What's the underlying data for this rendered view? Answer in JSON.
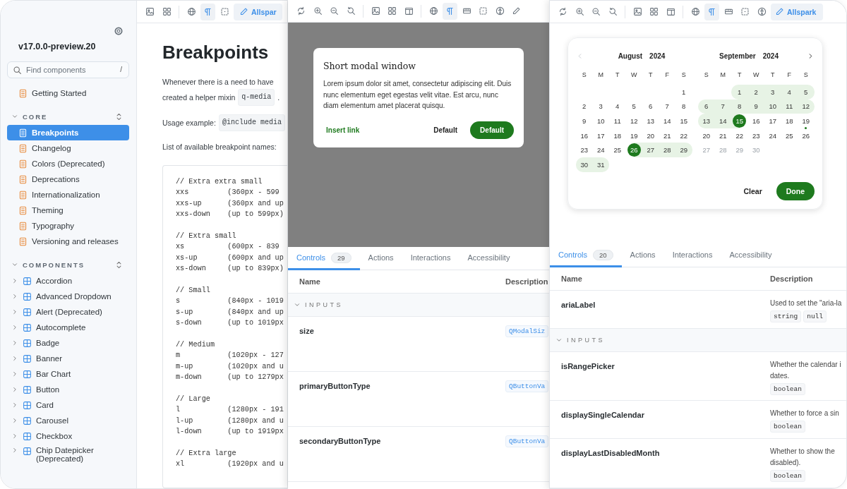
{
  "docs_window": {
    "sidebar": {
      "version": "v17.0.0-preview.20",
      "search": {
        "placeholder": "Find components",
        "shortcut": "/"
      },
      "top_items": [
        {
          "label": "Getting Started",
          "kind": "doc",
          "selected": false
        }
      ],
      "sections": [
        {
          "title": "CORE",
          "expanded": true,
          "items": [
            {
              "label": "Breakpoints",
              "kind": "doc",
              "selected": true
            },
            {
              "label": "Changelog",
              "kind": "doc",
              "selected": false
            },
            {
              "label": "Colors (Deprecated)",
              "kind": "doc",
              "selected": false
            },
            {
              "label": "Deprecations",
              "kind": "doc",
              "selected": false
            },
            {
              "label": "Internationalization",
              "kind": "doc",
              "selected": false
            },
            {
              "label": "Theming",
              "kind": "doc",
              "selected": false
            },
            {
              "label": "Typography",
              "kind": "doc",
              "selected": false
            },
            {
              "label": "Versioning and releases",
              "kind": "doc",
              "selected": false
            }
          ]
        },
        {
          "title": "COMPONENTS",
          "expanded": true,
          "items": [
            {
              "label": "Accordion",
              "kind": "component",
              "selected": false,
              "expanded": false
            },
            {
              "label": "Advanced Dropdown",
              "kind": "component",
              "selected": false,
              "expanded": false
            },
            {
              "label": "Alert (Deprecated)",
              "kind": "component",
              "selected": false,
              "expanded": false
            },
            {
              "label": "Autocomplete",
              "kind": "component",
              "selected": false,
              "expanded": false
            },
            {
              "label": "Badge",
              "kind": "component",
              "selected": false,
              "expanded": false
            },
            {
              "label": "Banner",
              "kind": "component",
              "selected": false,
              "expanded": false
            },
            {
              "label": "Bar Chart",
              "kind": "component",
              "selected": false,
              "expanded": false
            },
            {
              "label": "Button",
              "kind": "component",
              "selected": false,
              "expanded": false
            },
            {
              "label": "Card",
              "kind": "component",
              "selected": false,
              "expanded": false
            },
            {
              "label": "Carousel",
              "kind": "component",
              "selected": false,
              "expanded": false
            },
            {
              "label": "Checkbox",
              "kind": "component",
              "selected": false,
              "expanded": false
            },
            {
              "label": "Chip Datepicker (Deprecated)",
              "kind": "component",
              "selected": false,
              "expanded": false
            }
          ]
        }
      ]
    },
    "toolbar": [
      {
        "kind": "background",
        "selected": false
      },
      {
        "kind": "grid",
        "selected": false
      },
      {
        "kind": "separator"
      },
      {
        "kind": "locale",
        "selected": false
      },
      {
        "kind": "direction",
        "selected": true
      },
      {
        "kind": "outline",
        "selected": false
      },
      {
        "kind": "edit",
        "label": "Allspar"
      }
    ],
    "content": {
      "title": "Breakpoints",
      "paragraphs": [
        [
          {
            "text": "Whenever there is a need to have"
          }
        ],
        [
          {
            "text": "created a helper mixin"
          },
          {
            "code": "q-media"
          },
          {
            "text": "."
          }
        ],
        [
          {
            "text": "Usage example:"
          },
          {
            "code": "@include media"
          }
        ],
        [
          {
            "text": "List of available breakpoint names:"
          }
        ]
      ],
      "code_block": [
        {
          "comment": "// Extra extra small",
          "lines": [
            "xxs         (360px - 599",
            "xxs-up      (360px and up",
            "xxs-down    (up to 599px)"
          ]
        },
        {
          "comment": "// Extra small",
          "lines": [
            "xs          (600px - 839",
            "xs-up       (600px and up",
            "xs-down     (up to 839px)"
          ]
        },
        {
          "comment": "// Small",
          "lines": [
            "s           (840px - 1019",
            "s-up        (840px and up",
            "s-down      (up to 1019px"
          ]
        },
        {
          "comment": "// Medium",
          "lines": [
            "m           (1020px - 127",
            "m-up        (1020px and u",
            "m-down      (up to 1279px"
          ]
        },
        {
          "comment": "// Large",
          "lines": [
            "l           (1280px - 191",
            "l-up        (1280px and u",
            "l-down      (up to 1919px"
          ]
        },
        {
          "comment": "// Extra large",
          "lines": [
            "xl          (1920px and u"
          ]
        }
      ]
    }
  },
  "modal_window": {
    "toolbar": [
      {
        "kind": "reload",
        "selected": false
      },
      {
        "kind": "zoom-in",
        "selected": false
      },
      {
        "kind": "zoom-out",
        "selected": false
      },
      {
        "kind": "zoom-reset",
        "selected": false
      },
      {
        "kind": "separator"
      },
      {
        "kind": "background",
        "selected": false
      },
      {
        "kind": "grid",
        "selected": false
      },
      {
        "kind": "viewport",
        "selected": false
      },
      {
        "kind": "separator"
      },
      {
        "kind": "locale",
        "selected": false
      },
      {
        "kind": "direction",
        "selected": true
      },
      {
        "kind": "measure",
        "selected": false
      },
      {
        "kind": "outline",
        "selected": false
      },
      {
        "kind": "accessibility",
        "selected": false
      },
      {
        "kind": "edit"
      }
    ],
    "modal": {
      "title": "Short modal window",
      "body": "Lorem ipsum dolor sit amet, consectetur adipiscing elit. Duis nunc elementum eget egestas velit vitae. Est arcu, nunc diam elementum amet placerat quisqu.",
      "link": "Insert link",
      "secondary_button": "Default",
      "primary_button": "Default"
    },
    "addons": {
      "tabs": [
        {
          "label": "Controls",
          "badge": "29",
          "selected": true
        },
        {
          "label": "Actions",
          "selected": false
        },
        {
          "label": "Interactions",
          "selected": false
        },
        {
          "label": "Accessibility",
          "selected": false
        }
      ],
      "columns": [
        "Name",
        "Description"
      ],
      "rows": [
        {
          "kind": "group",
          "title": "INPUTS",
          "expanded": true
        },
        {
          "kind": "prop",
          "name": "size",
          "types": [
            {
              "label": "QModalSiz",
              "kind": "reference"
            }
          ]
        },
        {
          "kind": "prop",
          "name": "primaryButtonType",
          "types": [
            {
              "label": "QButtonVa",
              "kind": "reference"
            }
          ]
        },
        {
          "kind": "prop",
          "name": "secondaryButtonType",
          "types": [
            {
              "label": "QButtonVa",
              "kind": "reference"
            }
          ]
        }
      ]
    }
  },
  "datepicker_window": {
    "toolbar": [
      {
        "kind": "reload",
        "selected": false
      },
      {
        "kind": "zoom-in",
        "selected": false
      },
      {
        "kind": "zoom-out",
        "selected": false
      },
      {
        "kind": "zoom-reset",
        "selected": false
      },
      {
        "kind": "separator"
      },
      {
        "kind": "background",
        "selected": false
      },
      {
        "kind": "grid",
        "selected": false
      },
      {
        "kind": "viewport",
        "selected": false
      },
      {
        "kind": "separator"
      },
      {
        "kind": "locale",
        "selected": false
      },
      {
        "kind": "direction",
        "selected": true
      },
      {
        "kind": "measure",
        "selected": false
      },
      {
        "kind": "outline",
        "selected": false
      },
      {
        "kind": "accessibility",
        "selected": false
      },
      {
        "kind": "edit",
        "label": "Allspark"
      }
    ],
    "calendar": {
      "prev_button": {
        "disabled": true
      },
      "next_button": {
        "disabled": false
      },
      "months": [
        {
          "month": "August",
          "year": "2024",
          "weekdays": [
            "S",
            "M",
            "T",
            "W",
            "T",
            "F",
            "S"
          ],
          "weeks": [
            {
              "align_end": true,
              "days": [
                {
                  "label": "1",
                  "selected": false,
                  "in_range": false,
                  "disabled": false,
                  "today": false
                }
              ]
            },
            {
              "days": [
                {
                  "label": "2",
                  "selected": false,
                  "in_range": false,
                  "disabled": false,
                  "today": false
                },
                {
                  "label": "3",
                  "selected": false,
                  "in_range": false,
                  "disabled": false,
                  "today": false
                },
                {
                  "label": "4",
                  "selected": false,
                  "in_range": false,
                  "disabled": false,
                  "today": false
                },
                {
                  "label": "5",
                  "selected": false,
                  "in_range": false,
                  "disabled": false,
                  "today": false
                },
                {
                  "label": "6",
                  "selected": false,
                  "in_range": false,
                  "disabled": false,
                  "today": false
                },
                {
                  "label": "7",
                  "selected": false,
                  "in_range": false,
                  "disabled": false,
                  "today": false
                },
                {
                  "label": "8",
                  "selected": false,
                  "in_range": false,
                  "disabled": false,
                  "today": false
                }
              ]
            },
            {
              "days": [
                {
                  "label": "9",
                  "selected": false,
                  "in_range": false,
                  "disabled": false,
                  "today": false
                },
                {
                  "label": "10",
                  "selected": false,
                  "in_range": false,
                  "disabled": false,
                  "today": false
                },
                {
                  "label": "11",
                  "selected": false,
                  "in_range": false,
                  "disabled": false,
                  "today": false
                },
                {
                  "label": "12",
                  "selected": false,
                  "in_range": false,
                  "disabled": false,
                  "today": false
                },
                {
                  "label": "13",
                  "selected": false,
                  "in_range": false,
                  "disabled": false,
                  "today": false
                },
                {
                  "label": "14",
                  "selected": false,
                  "in_range": false,
                  "disabled": false,
                  "today": false
                },
                {
                  "label": "15",
                  "selected": false,
                  "in_range": false,
                  "disabled": false,
                  "today": false
                }
              ]
            },
            {
              "days": [
                {
                  "label": "16",
                  "selected": false,
                  "in_range": false,
                  "disabled": false,
                  "today": false
                },
                {
                  "label": "17",
                  "selected": false,
                  "in_range": false,
                  "disabled": false,
                  "today": false
                },
                {
                  "label": "18",
                  "selected": false,
                  "in_range": false,
                  "disabled": false,
                  "today": false
                },
                {
                  "label": "19",
                  "selected": false,
                  "in_range": false,
                  "disabled": false,
                  "today": false
                },
                {
                  "label": "20",
                  "selected": false,
                  "in_range": false,
                  "disabled": false,
                  "today": false
                },
                {
                  "label": "21",
                  "selected": false,
                  "in_range": false,
                  "disabled": false,
                  "today": false
                },
                {
                  "label": "22",
                  "selected": false,
                  "in_range": false,
                  "disabled": false,
                  "today": false
                }
              ]
            },
            {
              "days": [
                {
                  "label": "23",
                  "selected": false,
                  "in_range": false,
                  "disabled": false,
                  "today": false
                },
                {
                  "label": "24",
                  "selected": false,
                  "in_range": false,
                  "disabled": false,
                  "today": false
                },
                {
                  "label": "25",
                  "selected": false,
                  "in_range": false,
                  "disabled": false,
                  "today": false
                },
                {
                  "label": "26",
                  "selected": true,
                  "in_range": false,
                  "disabled": false,
                  "today": false
                },
                {
                  "label": "27",
                  "selected": false,
                  "in_range": true,
                  "disabled": false,
                  "today": false
                },
                {
                  "label": "28",
                  "selected": false,
                  "in_range": true,
                  "disabled": false,
                  "today": false
                },
                {
                  "label": "29",
                  "selected": false,
                  "in_range": true,
                  "disabled": false,
                  "today": false
                }
              ]
            },
            {
              "align_end": false,
              "days": [
                {
                  "label": "30",
                  "selected": false,
                  "in_range": true,
                  "disabled": false,
                  "today": false
                },
                {
                  "label": "31",
                  "selected": false,
                  "in_range": true,
                  "disabled": false,
                  "today": false
                }
              ]
            }
          ]
        },
        {
          "month": "September",
          "year": "2024",
          "weekdays": [
            "S",
            "M",
            "T",
            "W",
            "T",
            "F",
            "S"
          ],
          "weeks": [
            {
              "align_end": true,
              "days": [
                {
                  "label": "1",
                  "selected": false,
                  "in_range": true,
                  "disabled": false,
                  "today": false
                },
                {
                  "label": "2",
                  "selected": false,
                  "in_range": true,
                  "disabled": false,
                  "today": false
                },
                {
                  "label": "3",
                  "selected": false,
                  "in_range": true,
                  "disabled": false,
                  "today": false
                },
                {
                  "label": "4",
                  "selected": false,
                  "in_range": true,
                  "disabled": false,
                  "today": false
                },
                {
                  "label": "5",
                  "selected": false,
                  "in_range": true,
                  "disabled": false,
                  "today": false
                }
              ]
            },
            {
              "days": [
                {
                  "label": "6",
                  "selected": false,
                  "in_range": true,
                  "disabled": false,
                  "today": false
                },
                {
                  "label": "7",
                  "selected": false,
                  "in_range": true,
                  "disabled": false,
                  "today": false
                },
                {
                  "label": "8",
                  "selected": false,
                  "in_range": true,
                  "disabled": false,
                  "today": false
                },
                {
                  "label": "9",
                  "selected": false,
                  "in_range": true,
                  "disabled": false,
                  "today": false
                },
                {
                  "label": "10",
                  "selected": false,
                  "in_range": true,
                  "disabled": false,
                  "today": false
                },
                {
                  "label": "11",
                  "selected": false,
                  "in_range": true,
                  "disabled": false,
                  "today": false
                },
                {
                  "label": "12",
                  "selected": false,
                  "in_range": true,
                  "disabled": false,
                  "today": false
                }
              ]
            },
            {
              "days": [
                {
                  "label": "13",
                  "selected": false,
                  "in_range": true,
                  "disabled": false,
                  "today": false
                },
                {
                  "label": "14",
                  "selected": false,
                  "in_range": true,
                  "disabled": false,
                  "today": false
                },
                {
                  "label": "15",
                  "selected": true,
                  "in_range": false,
                  "disabled": false,
                  "today": false
                },
                {
                  "label": "16",
                  "selected": false,
                  "in_range": false,
                  "disabled": false,
                  "today": false
                },
                {
                  "label": "17",
                  "selected": false,
                  "in_range": false,
                  "disabled": false,
                  "today": false
                },
                {
                  "label": "18",
                  "selected": false,
                  "in_range": false,
                  "disabled": false,
                  "today": false
                },
                {
                  "label": "19",
                  "selected": false,
                  "in_range": false,
                  "disabled": false,
                  "today": true
                }
              ]
            },
            {
              "days": [
                {
                  "label": "20",
                  "selected": false,
                  "in_range": false,
                  "disabled": false,
                  "today": false
                },
                {
                  "label": "21",
                  "selected": false,
                  "in_range": false,
                  "disabled": false,
                  "today": false
                },
                {
                  "label": "22",
                  "selected": false,
                  "in_range": false,
                  "disabled": false,
                  "today": false
                },
                {
                  "label": "23",
                  "selected": false,
                  "in_range": false,
                  "disabled": false,
                  "today": false
                },
                {
                  "label": "24",
                  "selected": false,
                  "in_range": false,
                  "disabled": false,
                  "today": false
                },
                {
                  "label": "25",
                  "selected": false,
                  "in_range": false,
                  "disabled": false,
                  "today": false
                },
                {
                  "label": "26",
                  "selected": false,
                  "in_range": false,
                  "disabled": false,
                  "today": false
                }
              ]
            },
            {
              "align_end": false,
              "days": [
                {
                  "label": "27",
                  "selected": false,
                  "in_range": false,
                  "disabled": true,
                  "today": false
                },
                {
                  "label": "28",
                  "selected": false,
                  "in_range": false,
                  "disabled": true,
                  "today": false
                },
                {
                  "label": "29",
                  "selected": false,
                  "in_range": false,
                  "disabled": true,
                  "today": false
                },
                {
                  "label": "30",
                  "selected": false,
                  "in_range": false,
                  "disabled": true,
                  "today": false
                }
              ]
            }
          ]
        }
      ],
      "clear_button": "Clear",
      "done_button": "Done"
    },
    "addons": {
      "tabs": [
        {
          "label": "Controls",
          "badge": "20",
          "selected": true
        },
        {
          "label": "Actions",
          "selected": false
        },
        {
          "label": "Interactions",
          "selected": false
        },
        {
          "label": "Accessibility",
          "selected": false
        }
      ],
      "columns": [
        "Name",
        "Description"
      ],
      "rows": [
        {
          "kind": "prop",
          "name": "ariaLabel",
          "description": [
            "Used to set the \"aria-la"
          ],
          "types": [
            {
              "label": "string",
              "kind": "plain"
            },
            {
              "label": "null",
              "kind": "plain"
            }
          ]
        },
        {
          "kind": "group",
          "title": "INPUTS",
          "expanded": true
        },
        {
          "kind": "prop",
          "name": "isRangePicker",
          "description": [
            "Whether the calendar i",
            "dates."
          ],
          "types": [
            {
              "label": "boolean",
              "kind": "plain"
            }
          ]
        },
        {
          "kind": "prop",
          "name": "displaySingleCalendar",
          "description": [
            "Whether to force a sin"
          ],
          "types": [
            {
              "label": "boolean",
              "kind": "plain"
            }
          ]
        },
        {
          "kind": "prop",
          "name": "displayLastDisabledMonth",
          "description": [
            "Whether to show the",
            "disabled)."
          ],
          "types": [
            {
              "label": "boolean",
              "kind": "plain"
            }
          ]
        }
      ]
    }
  }
}
